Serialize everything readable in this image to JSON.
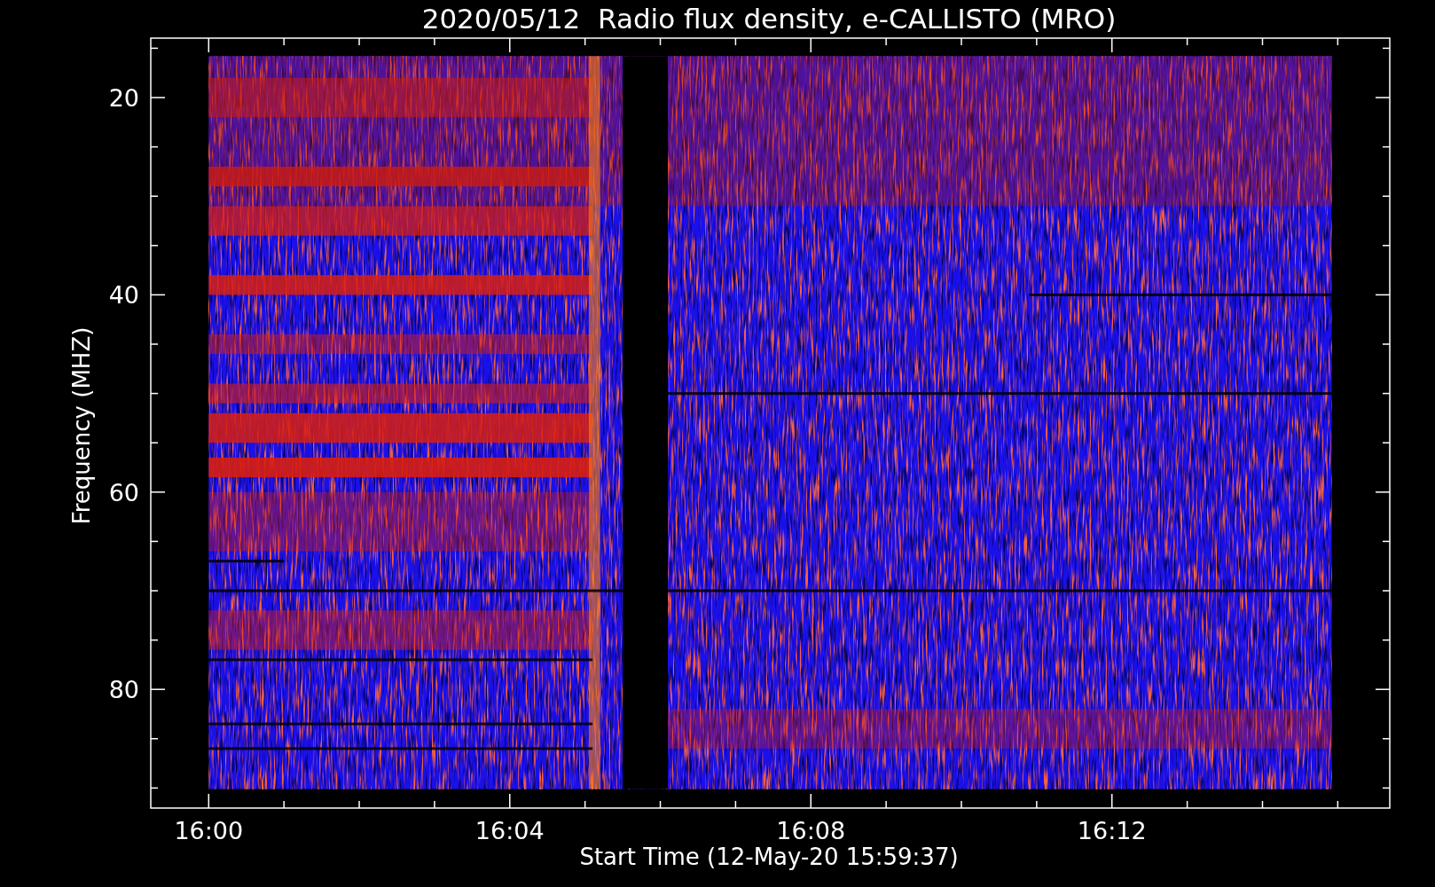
{
  "chart": {
    "title": "2020/05/12  Radio flux density, e-CALLISTO (MRO)",
    "xlabel": "Start Time (12-May-20 15:59:37)",
    "ylabel": "Frequency (MHZ)",
    "xticks": [
      "16:00",
      "16:04",
      "16:08",
      "16:12"
    ],
    "yticks": [
      "20",
      "40",
      "60",
      "80"
    ]
  }
}
